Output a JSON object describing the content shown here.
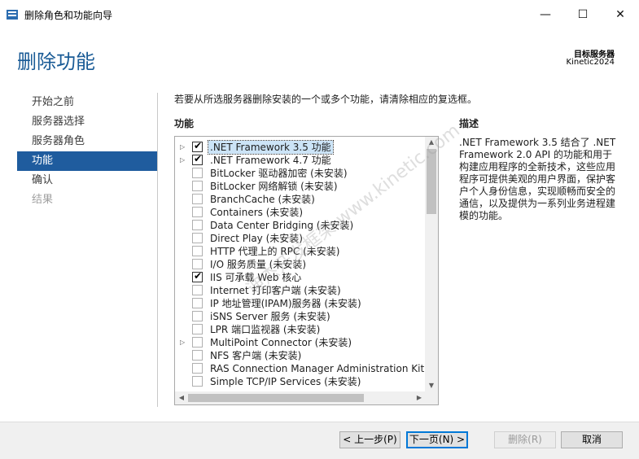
{
  "window": {
    "title": "删除角色和功能向导",
    "minimize": "—",
    "maximize": "☐",
    "close": "✕"
  },
  "header": {
    "title": "删除功能",
    "server_label": "目标服务器",
    "server_name": "Kinetic2024"
  },
  "nav": [
    {
      "label": "开始之前",
      "state": "normal"
    },
    {
      "label": "服务器选择",
      "state": "normal"
    },
    {
      "label": "服务器角色",
      "state": "normal"
    },
    {
      "label": "功能",
      "state": "active"
    },
    {
      "label": "确认",
      "state": "normal"
    },
    {
      "label": "结果",
      "state": "disabled"
    }
  ],
  "main": {
    "instruction": "若要从所选服务器删除安装的一个或多个功能，请清除相应的复选框。",
    "features_label": "功能",
    "features": [
      {
        "label": ".NET Framework 3.5 功能",
        "checked": true,
        "expandable": true,
        "selected": true
      },
      {
        "label": ".NET Framework 4.7 功能",
        "checked": true,
        "expandable": true
      },
      {
        "label": "BitLocker 驱动器加密 (未安装)",
        "checked": false
      },
      {
        "label": "BitLocker 网络解锁 (未安装)",
        "checked": false
      },
      {
        "label": "BranchCache (未安装)",
        "checked": false
      },
      {
        "label": "Containers (未安装)",
        "checked": false
      },
      {
        "label": "Data Center Bridging (未安装)",
        "checked": false
      },
      {
        "label": "Direct Play (未安装)",
        "checked": false
      },
      {
        "label": "HTTP 代理上的 RPC (未安装)",
        "checked": false
      },
      {
        "label": "I/O 服务质量 (未安装)",
        "checked": false
      },
      {
        "label": "IIS 可承载 Web 核心",
        "checked": true
      },
      {
        "label": "Internet 打印客户端 (未安装)",
        "checked": false
      },
      {
        "label": "IP 地址管理(IPAM)服务器 (未安装)",
        "checked": false
      },
      {
        "label": "iSNS Server 服务 (未安装)",
        "checked": false
      },
      {
        "label": "LPR 端口监视器 (未安装)",
        "checked": false
      },
      {
        "label": "MultiPoint Connector (未安装)",
        "checked": false,
        "expandable": true
      },
      {
        "label": "NFS 客户端 (未安装)",
        "checked": false
      },
      {
        "label": "RAS Connection Manager Administration Kit (C",
        "checked": false
      },
      {
        "label": "Simple TCP/IP Services (未安装)",
        "checked": false
      }
    ],
    "description_label": "描述",
    "description": ".NET Framework 3.5 结合了 .NET Framework 2.0 API 的功能和用于构建应用程序的全新技术，这些应用程序可提供美观的用户界面，保护客户个人身份信息，实现顺畅而安全的通信，以及提供为一系列业务进程建模的功能。"
  },
  "watermark": "迪杰开发框架 www.kinetic.com",
  "footer": {
    "prev": "< 上一步(P)",
    "next": "下一页(N) >",
    "remove": "删除(R)",
    "cancel": "取消"
  }
}
